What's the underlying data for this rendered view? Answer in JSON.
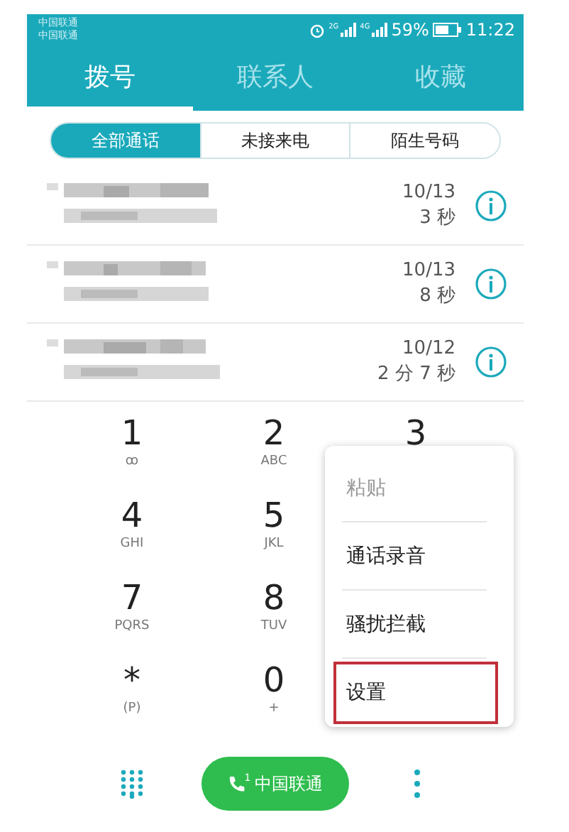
{
  "status_bar": {
    "carriers": [
      "中国联通",
      "中国联通"
    ],
    "signals": [
      "2G",
      "4G"
    ],
    "battery": "59%",
    "time": "11:22"
  },
  "tabs": [
    {
      "label": "拨号",
      "selected": true
    },
    {
      "label": "联系人",
      "selected": false
    },
    {
      "label": "收藏",
      "selected": false
    }
  ],
  "filters": [
    {
      "label": "全部通话",
      "selected": true
    },
    {
      "label": "未接来电",
      "selected": false
    },
    {
      "label": "陌生号码",
      "selected": false
    }
  ],
  "calls": [
    {
      "date": "10/13",
      "duration": "3 秒"
    },
    {
      "date": "10/13",
      "duration": "8 秒"
    },
    {
      "date": "10/12",
      "duration": "2 分 7 秒"
    }
  ],
  "keypad": [
    [
      {
        "digit": "1",
        "letters": "ꝏ"
      },
      {
        "digit": "2",
        "letters": "ABC"
      },
      {
        "digit": "3"
      }
    ],
    [
      {
        "digit": "4",
        "letters": "GHI"
      },
      {
        "digit": "5",
        "letters": "JKL"
      }
    ],
    [
      {
        "digit": "7",
        "letters": "PQRS"
      },
      {
        "digit": "8",
        "letters": "TUV"
      }
    ],
    [
      {
        "digit": "*",
        "letters": "(P)"
      },
      {
        "digit": "0",
        "letters": "+"
      }
    ]
  ],
  "menu": [
    {
      "label": "粘贴",
      "disabled": true,
      "highlighted": false
    },
    {
      "label": "通话录音",
      "disabled": false,
      "highlighted": false
    },
    {
      "label": "骚扰拦截",
      "disabled": false,
      "highlighted": false
    },
    {
      "label": "设置",
      "disabled": false,
      "highlighted": true
    }
  ],
  "call_button": {
    "sim": "1",
    "label": "中国联通"
  }
}
